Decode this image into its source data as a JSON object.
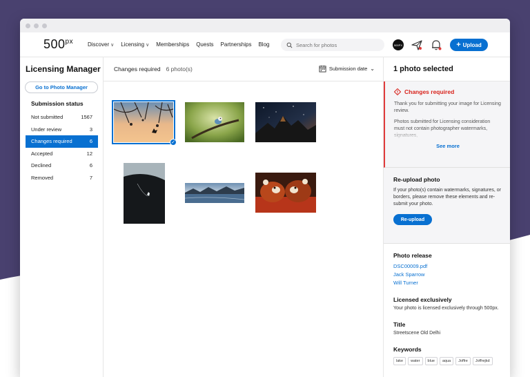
{
  "colors": {
    "accent": "#0870d1",
    "alert": "#d8231c",
    "background": "#49416f"
  },
  "nav": {
    "logo": "500px",
    "links": [
      {
        "label": "Discover",
        "dropdown": true
      },
      {
        "label": "Licensing",
        "dropdown": true
      },
      {
        "label": "Memberships",
        "dropdown": false
      },
      {
        "label": "Quests",
        "dropdown": false
      },
      {
        "label": "Partnerships",
        "dropdown": false
      },
      {
        "label": "Blog",
        "dropdown": false
      }
    ],
    "search_placeholder": "Search for photos",
    "avatar_text": "500PX",
    "upload_label": "Upload"
  },
  "sidebar": {
    "title": "Licensing Manager",
    "photo_manager_button": "Go to Photo Manager",
    "status_title": "Submission status",
    "statuses": [
      {
        "label": "Not submitted",
        "count": "1567",
        "active": false
      },
      {
        "label": "Under review",
        "count": "3",
        "active": false
      },
      {
        "label": "Changes required",
        "count": "6",
        "active": true
      },
      {
        "label": "Accepted",
        "count": "12",
        "active": false
      },
      {
        "label": "Declined",
        "count": "6",
        "active": false
      },
      {
        "label": "Removed",
        "count": "7",
        "active": false
      }
    ]
  },
  "main": {
    "title": "Changes required",
    "count": "6 photo(s)",
    "sort_label": "Submission date",
    "photos": [
      {
        "name": "silhouette-climber",
        "selected": true
      },
      {
        "name": "bird-on-branch",
        "selected": false
      },
      {
        "name": "night-mountains",
        "selected": false
      },
      {
        "name": "cliff-climber",
        "selected": false
      },
      {
        "name": "lake-panorama",
        "selected": false
      },
      {
        "name": "red-pandas",
        "selected": false
      }
    ]
  },
  "panel": {
    "header": "1 photo selected",
    "changes_title": "Changes required",
    "changes_text": "Thank you for submitting your image for Licensing review.",
    "changes_text2": "Photos submitted for Licensing consideration must not contain photographer watermarks, signatures,",
    "see_more": "See more",
    "reupload_title": "Re-upload photo",
    "reupload_text": "If your photo(s) contain watermarks, signatures, or borders, please remove these elements and re-submit your photo.",
    "reupload_button": "Re-upload",
    "release_title": "Photo release",
    "release_links": [
      "DSC00009.pdf",
      "Jack Sparrow",
      "Will Turner"
    ],
    "exclusive_title": "Licensed exclusively",
    "exclusive_text": "Your photo is licensed exclusively through 500px.",
    "title_label": "Title",
    "title_value": "Streetscene Old Delhi",
    "keywords_label": "Keywords",
    "keywords": [
      "lake",
      "water",
      "blue",
      "aqua",
      "Joffre",
      "Joffrejkd"
    ]
  }
}
